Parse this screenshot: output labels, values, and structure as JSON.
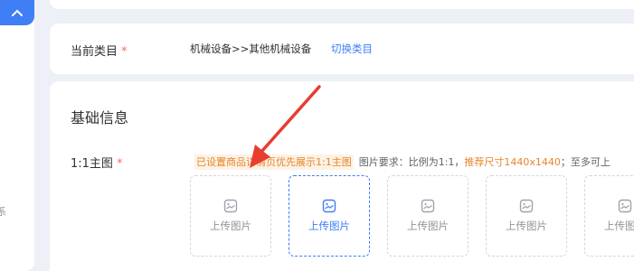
{
  "category": {
    "label": "当前类目",
    "required_mark": "*",
    "path": "机械设备>>其他机械设备",
    "switch_label": "切换类目"
  },
  "basic_info": {
    "title": "基础信息",
    "main_image_label": "1:1主图",
    "required_mark": "*",
    "hint_highlight": "已设置商品详情页优先展示1:1主图",
    "hint_requirement": "图片要求：比例为1:1，",
    "hint_size": "推荐尺寸1440x1440",
    "hint_tail": "；至多可上",
    "upload_tiles": [
      {
        "label": "上传图片",
        "active": false
      },
      {
        "label": "上传图片",
        "active": true
      },
      {
        "label": "上传图片",
        "active": false
      },
      {
        "label": "上传图片",
        "active": false
      },
      {
        "label": "上传图片",
        "active": false
      }
    ]
  },
  "sidebar": {
    "glyph": "系"
  },
  "colors": {
    "accent": "#3f7ef5",
    "required": "#f56c6c",
    "hint_orange": "#e6862b",
    "arrow": "#e83c2f"
  }
}
